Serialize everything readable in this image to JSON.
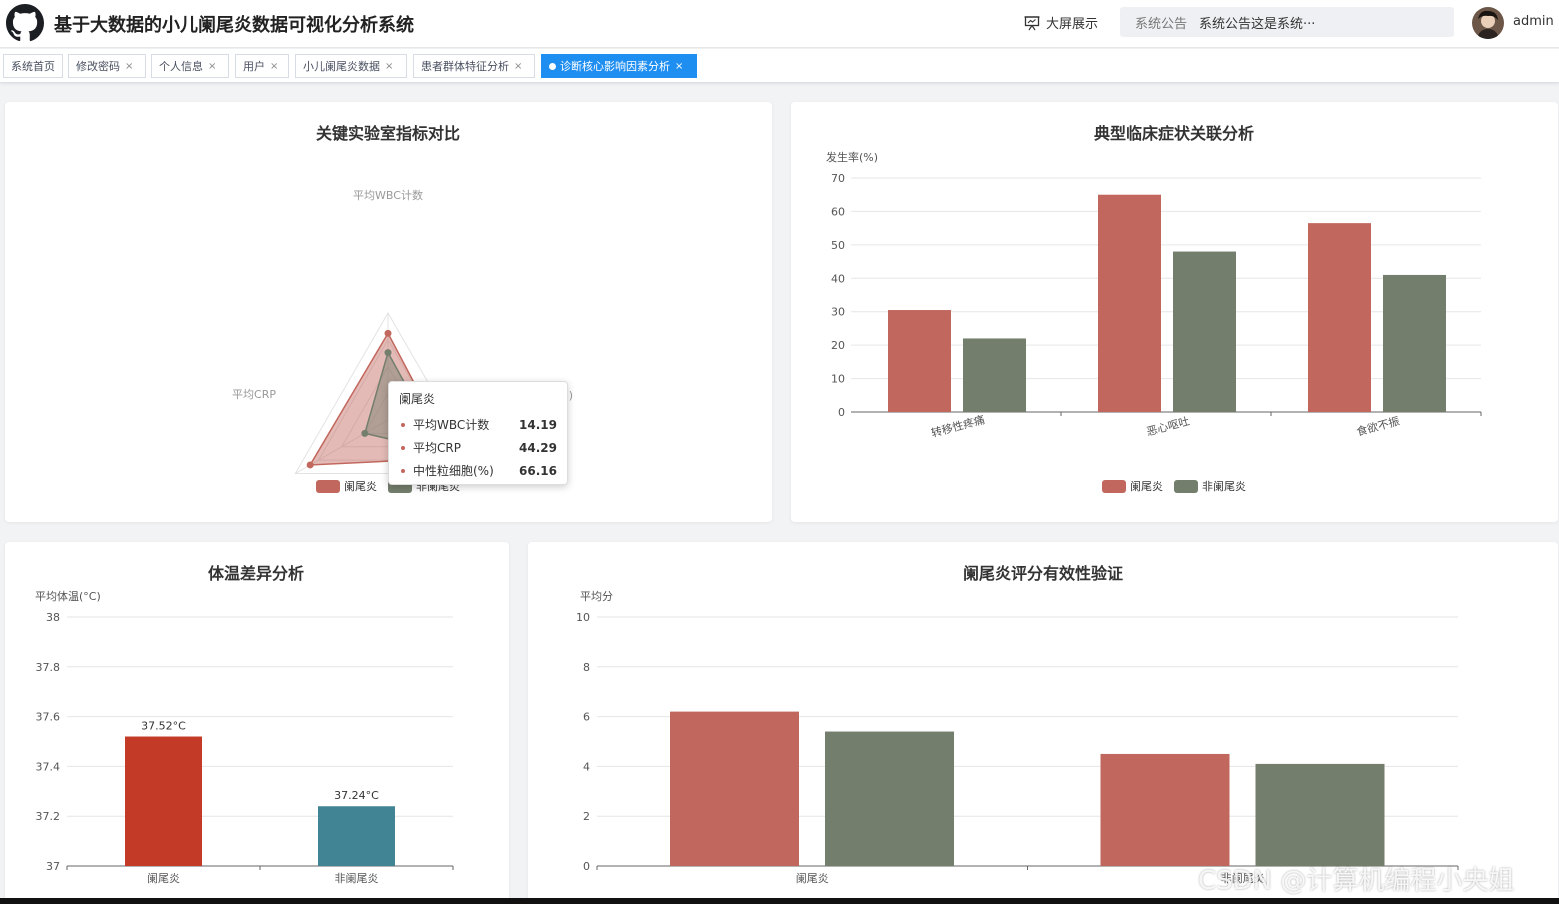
{
  "header": {
    "title": "基于大数据的小儿阑尾炎数据可视化分析系统",
    "bigscreen_label": "大屏展示",
    "notice_label": "系统公告",
    "notice_text": "系统公告这是系统···",
    "username": "admin"
  },
  "tabs": [
    {
      "label": "系统首页",
      "closable": false,
      "active": false
    },
    {
      "label": "修改密码",
      "closable": true,
      "active": false
    },
    {
      "label": "个人信息",
      "closable": true,
      "active": false
    },
    {
      "label": "用户",
      "closable": true,
      "active": false
    },
    {
      "label": "小儿阑尾炎数据",
      "closable": true,
      "active": false
    },
    {
      "label": "患者群体特征分析",
      "closable": true,
      "active": false
    },
    {
      "label": "诊断核心影响因素分析",
      "closable": true,
      "active": true
    }
  ],
  "colors": {
    "appendicitis": "#c2675d",
    "non_appendicitis": "#747e6d",
    "temp_appendicitis": "#c33b26",
    "temp_non_appendicitis": "#418493"
  },
  "tooltip": {
    "title": "阑尾炎",
    "rows": [
      {
        "name": "平均WBC计数",
        "value": "14.19"
      },
      {
        "name": "平均CRP",
        "value": "44.29"
      },
      {
        "name": "中性粒细胞(%)",
        "value": "66.16"
      }
    ]
  },
  "watermark": "CSDN @计算机编程小央姐",
  "chart_data": [
    {
      "type": "radar",
      "title": "关键实验室指标对比",
      "indicators": [
        "平均WBC计数",
        "平均CRP",
        "中性粒细胞(%)"
      ],
      "indicator_labels_visible": [
        "平均WBC计数",
        "平均CRP",
        "%)"
      ],
      "series": [
        {
          "name": "阑尾炎",
          "values": [
            0.81,
            0.84,
            0.71
          ]
        },
        {
          "name": "非阑尾炎",
          "values": [
            0.63,
            0.25,
            0.58
          ]
        }
      ],
      "legend": [
        "阑尾炎",
        "非阑尾炎"
      ],
      "legend_placement": "bottom"
    },
    {
      "type": "bar",
      "title": "典型临床症状关联分析",
      "ylabel": "发生率(%)",
      "ylim": [
        0,
        70
      ],
      "yticks": [
        0,
        10,
        20,
        30,
        40,
        50,
        60,
        70
      ],
      "categories": [
        "转移性疼痛",
        "恶心呕吐",
        "食欲不振"
      ],
      "series": [
        {
          "name": "阑尾炎",
          "values": [
            30.5,
            65,
            56.5
          ]
        },
        {
          "name": "非阑尾炎",
          "values": [
            22,
            48,
            41
          ]
        }
      ],
      "legend": [
        "阑尾炎",
        "非阑尾炎"
      ],
      "legend_placement": "bottom",
      "grid": true
    },
    {
      "type": "bar",
      "title": "体温差异分析",
      "ylabel": "平均体温(°C)",
      "ylim": [
        37,
        38
      ],
      "yticks": [
        "37",
        "37.2",
        "37.4",
        "37.6",
        "37.8",
        "38"
      ],
      "categories": [
        "阑尾炎",
        "非阑尾炎"
      ],
      "values": [
        37.52,
        37.24
      ],
      "data_labels": [
        "37.52°C",
        "37.24°C"
      ],
      "grid": true
    },
    {
      "type": "bar",
      "title": "阑尾炎评分有效性验证",
      "ylabel": "平均分",
      "ylim": [
        0,
        10
      ],
      "yticks": [
        0,
        2,
        4,
        6,
        8,
        10
      ],
      "categories": [
        "阑尾炎",
        "非阑尾炎"
      ],
      "series": [
        {
          "values": [
            6.2,
            4.5
          ]
        },
        {
          "values": [
            5.4,
            4.1
          ]
        }
      ],
      "grid": true
    }
  ]
}
